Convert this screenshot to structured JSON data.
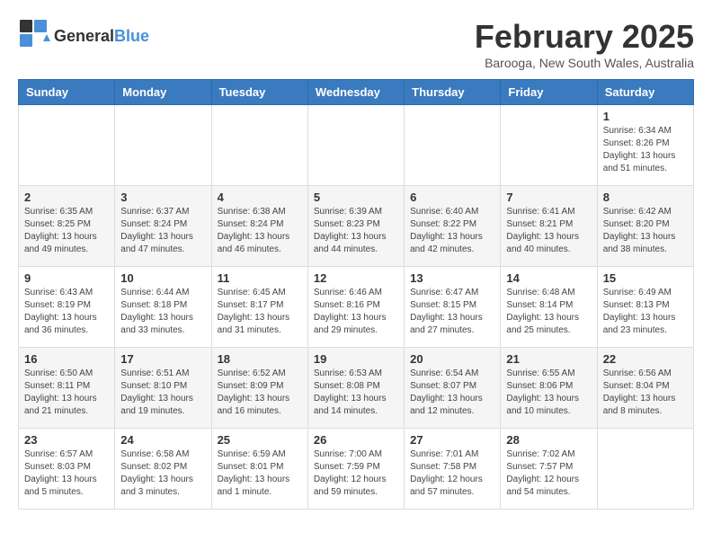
{
  "logo": {
    "general": "General",
    "blue": "Blue"
  },
  "title": "February 2025",
  "subtitle": "Barooga, New South Wales, Australia",
  "days_header": [
    "Sunday",
    "Monday",
    "Tuesday",
    "Wednesday",
    "Thursday",
    "Friday",
    "Saturday"
  ],
  "weeks": [
    [
      {
        "day": "",
        "info": ""
      },
      {
        "day": "",
        "info": ""
      },
      {
        "day": "",
        "info": ""
      },
      {
        "day": "",
        "info": ""
      },
      {
        "day": "",
        "info": ""
      },
      {
        "day": "",
        "info": ""
      },
      {
        "day": "1",
        "info": "Sunrise: 6:34 AM\nSunset: 8:26 PM\nDaylight: 13 hours\nand 51 minutes."
      }
    ],
    [
      {
        "day": "2",
        "info": "Sunrise: 6:35 AM\nSunset: 8:25 PM\nDaylight: 13 hours\nand 49 minutes."
      },
      {
        "day": "3",
        "info": "Sunrise: 6:37 AM\nSunset: 8:24 PM\nDaylight: 13 hours\nand 47 minutes."
      },
      {
        "day": "4",
        "info": "Sunrise: 6:38 AM\nSunset: 8:24 PM\nDaylight: 13 hours\nand 46 minutes."
      },
      {
        "day": "5",
        "info": "Sunrise: 6:39 AM\nSunset: 8:23 PM\nDaylight: 13 hours\nand 44 minutes."
      },
      {
        "day": "6",
        "info": "Sunrise: 6:40 AM\nSunset: 8:22 PM\nDaylight: 13 hours\nand 42 minutes."
      },
      {
        "day": "7",
        "info": "Sunrise: 6:41 AM\nSunset: 8:21 PM\nDaylight: 13 hours\nand 40 minutes."
      },
      {
        "day": "8",
        "info": "Sunrise: 6:42 AM\nSunset: 8:20 PM\nDaylight: 13 hours\nand 38 minutes."
      }
    ],
    [
      {
        "day": "9",
        "info": "Sunrise: 6:43 AM\nSunset: 8:19 PM\nDaylight: 13 hours\nand 36 minutes."
      },
      {
        "day": "10",
        "info": "Sunrise: 6:44 AM\nSunset: 8:18 PM\nDaylight: 13 hours\nand 33 minutes."
      },
      {
        "day": "11",
        "info": "Sunrise: 6:45 AM\nSunset: 8:17 PM\nDaylight: 13 hours\nand 31 minutes."
      },
      {
        "day": "12",
        "info": "Sunrise: 6:46 AM\nSunset: 8:16 PM\nDaylight: 13 hours\nand 29 minutes."
      },
      {
        "day": "13",
        "info": "Sunrise: 6:47 AM\nSunset: 8:15 PM\nDaylight: 13 hours\nand 27 minutes."
      },
      {
        "day": "14",
        "info": "Sunrise: 6:48 AM\nSunset: 8:14 PM\nDaylight: 13 hours\nand 25 minutes."
      },
      {
        "day": "15",
        "info": "Sunrise: 6:49 AM\nSunset: 8:13 PM\nDaylight: 13 hours\nand 23 minutes."
      }
    ],
    [
      {
        "day": "16",
        "info": "Sunrise: 6:50 AM\nSunset: 8:11 PM\nDaylight: 13 hours\nand 21 minutes."
      },
      {
        "day": "17",
        "info": "Sunrise: 6:51 AM\nSunset: 8:10 PM\nDaylight: 13 hours\nand 19 minutes."
      },
      {
        "day": "18",
        "info": "Sunrise: 6:52 AM\nSunset: 8:09 PM\nDaylight: 13 hours\nand 16 minutes."
      },
      {
        "day": "19",
        "info": "Sunrise: 6:53 AM\nSunset: 8:08 PM\nDaylight: 13 hours\nand 14 minutes."
      },
      {
        "day": "20",
        "info": "Sunrise: 6:54 AM\nSunset: 8:07 PM\nDaylight: 13 hours\nand 12 minutes."
      },
      {
        "day": "21",
        "info": "Sunrise: 6:55 AM\nSunset: 8:06 PM\nDaylight: 13 hours\nand 10 minutes."
      },
      {
        "day": "22",
        "info": "Sunrise: 6:56 AM\nSunset: 8:04 PM\nDaylight: 13 hours\nand 8 minutes."
      }
    ],
    [
      {
        "day": "23",
        "info": "Sunrise: 6:57 AM\nSunset: 8:03 PM\nDaylight: 13 hours\nand 5 minutes."
      },
      {
        "day": "24",
        "info": "Sunrise: 6:58 AM\nSunset: 8:02 PM\nDaylight: 13 hours\nand 3 minutes."
      },
      {
        "day": "25",
        "info": "Sunrise: 6:59 AM\nSunset: 8:01 PM\nDaylight: 13 hours\nand 1 minute."
      },
      {
        "day": "26",
        "info": "Sunrise: 7:00 AM\nSunset: 7:59 PM\nDaylight: 12 hours\nand 59 minutes."
      },
      {
        "day": "27",
        "info": "Sunrise: 7:01 AM\nSunset: 7:58 PM\nDaylight: 12 hours\nand 57 minutes."
      },
      {
        "day": "28",
        "info": "Sunrise: 7:02 AM\nSunset: 7:57 PM\nDaylight: 12 hours\nand 54 minutes."
      },
      {
        "day": "",
        "info": ""
      }
    ]
  ]
}
